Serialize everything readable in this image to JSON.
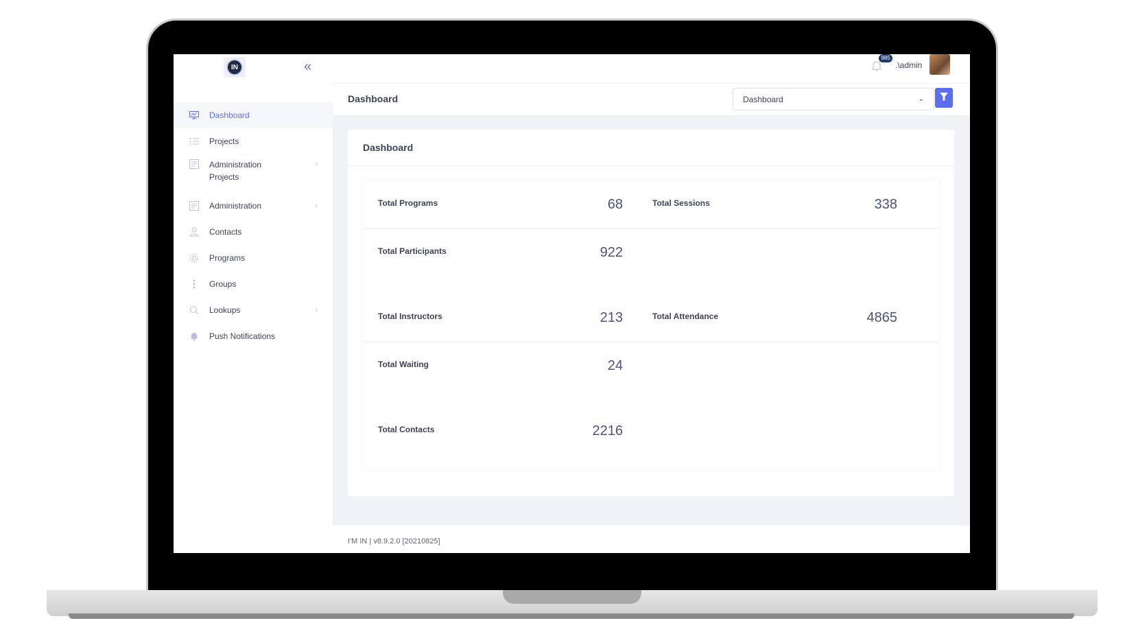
{
  "app": {
    "logo_text": "IN"
  },
  "sidebar": {
    "items": [
      {
        "label": "Dashboard",
        "icon": "monitor-icon"
      },
      {
        "label": "Projects",
        "icon": "list-icon"
      },
      {
        "label": "Administration",
        "sub": "Projects",
        "icon": "admin-icon"
      },
      {
        "label": "Administration",
        "icon": "admin-icon"
      },
      {
        "label": "Contacts",
        "icon": "contacts-icon"
      },
      {
        "label": "Programs",
        "icon": "gear-icon"
      },
      {
        "label": "Groups",
        "icon": "dots-icon"
      },
      {
        "label": "Lookups",
        "icon": "search-icon"
      },
      {
        "label": "Push Notifications",
        "icon": "bell-icon"
      }
    ]
  },
  "header": {
    "notification_count": "985",
    "user": ".\\admin"
  },
  "titlebar": {
    "title": "Dashboard",
    "select_value": "Dashboard"
  },
  "card": {
    "title": "Dashboard",
    "stats": [
      {
        "label": "Total Programs",
        "value": "68"
      },
      {
        "label": "Total Sessions",
        "value": "338"
      },
      {
        "label": "Total Participants",
        "value": "922"
      },
      {
        "label": "Total Instructors",
        "value": "213"
      },
      {
        "label": "Total Attendance",
        "value": "4865"
      },
      {
        "label": "Total Waiting",
        "value": "24"
      },
      {
        "label": "Total Contacts",
        "value": "2216"
      }
    ]
  },
  "footer": {
    "text": "I'M IN | v8.9.2.0 [20210825]"
  },
  "colors": {
    "accent": "#5c6ef0",
    "text": "#3c4257",
    "value": "#4b527d",
    "page_bg": "#f1f2f6"
  }
}
